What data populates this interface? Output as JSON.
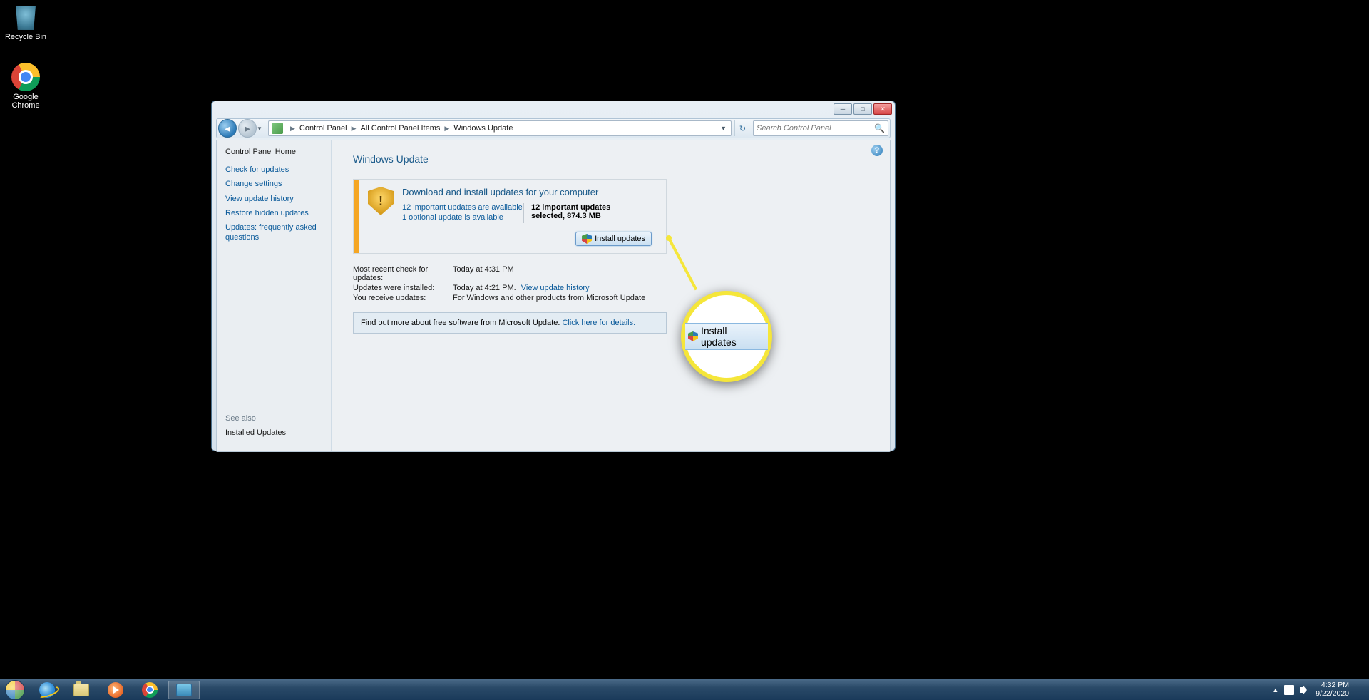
{
  "desktop_icons": {
    "recycle_bin": "Recycle Bin",
    "chrome": "Google\nChrome"
  },
  "window": {
    "min": "─",
    "max": "□",
    "close": "✕"
  },
  "breadcrumb": {
    "parts": [
      "Control Panel",
      "All Control Panel Items",
      "Windows Update"
    ]
  },
  "search": {
    "placeholder": "Search Control Panel"
  },
  "sidebar": {
    "home": "Control Panel Home",
    "links": [
      "Check for updates",
      "Change settings",
      "View update history",
      "Restore hidden updates",
      "Updates: frequently asked questions"
    ],
    "see_also": "See also",
    "installed": "Installed Updates"
  },
  "main": {
    "title": "Windows Update",
    "panel_heading": "Download and install updates for your computer",
    "important_link": "12 important updates are available",
    "optional_link": "1 optional update is available",
    "selected_text": "12 important updates selected, 874.3 MB",
    "install_button": "Install updates",
    "info": {
      "k1": "Most recent check for updates:",
      "v1": "Today at 4:31 PM",
      "k2": "Updates were installed:",
      "v2": "Today at 4:21 PM.",
      "v2_link": "View update history",
      "k3": "You receive updates:",
      "v3": "For Windows and other products from Microsoft Update"
    },
    "promo_text": "Find out more about free software from Microsoft Update. ",
    "promo_link": "Click here for details."
  },
  "callout": {
    "label": "Install updates"
  },
  "taskbar": {
    "time": "4:32 PM",
    "date": "9/22/2020"
  }
}
